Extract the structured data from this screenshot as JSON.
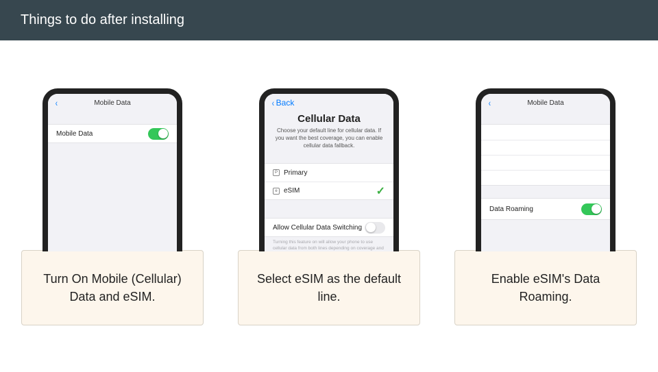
{
  "header": {
    "title": "Things to do after installing"
  },
  "steps": [
    {
      "nav_back_glyph": "‹",
      "nav_title": "Mobile Data",
      "rows": [
        {
          "label": "Mobile Data",
          "toggle_on": true
        }
      ],
      "caption": "Turn On Mobile (Cellular) Data and eSIM."
    },
    {
      "nav_back_glyph": "‹",
      "nav_back_text": "Back",
      "big_title": "Cellular Data",
      "description": "Choose your default line for cellular data. If you want the best coverage, you can enable cellular data fallback.",
      "options": [
        {
          "badge": "P",
          "label": "Primary",
          "checked": false
        },
        {
          "badge": "e",
          "label": "eSIM",
          "checked": true
        }
      ],
      "switch_row": {
        "label": "Allow Cellular Data Switching",
        "toggle_on": false
      },
      "footnote": "Turning this feature on will allow your phone to use cellular data from both lines depending on coverage and availability.",
      "caption": "Select eSIM as the default line."
    },
    {
      "nav_back_glyph": "‹",
      "nav_title": "Mobile Data",
      "roaming_row": {
        "label": "Data Roaming",
        "toggle_on": true
      },
      "caption": "Enable eSIM's Data Roaming."
    }
  ]
}
